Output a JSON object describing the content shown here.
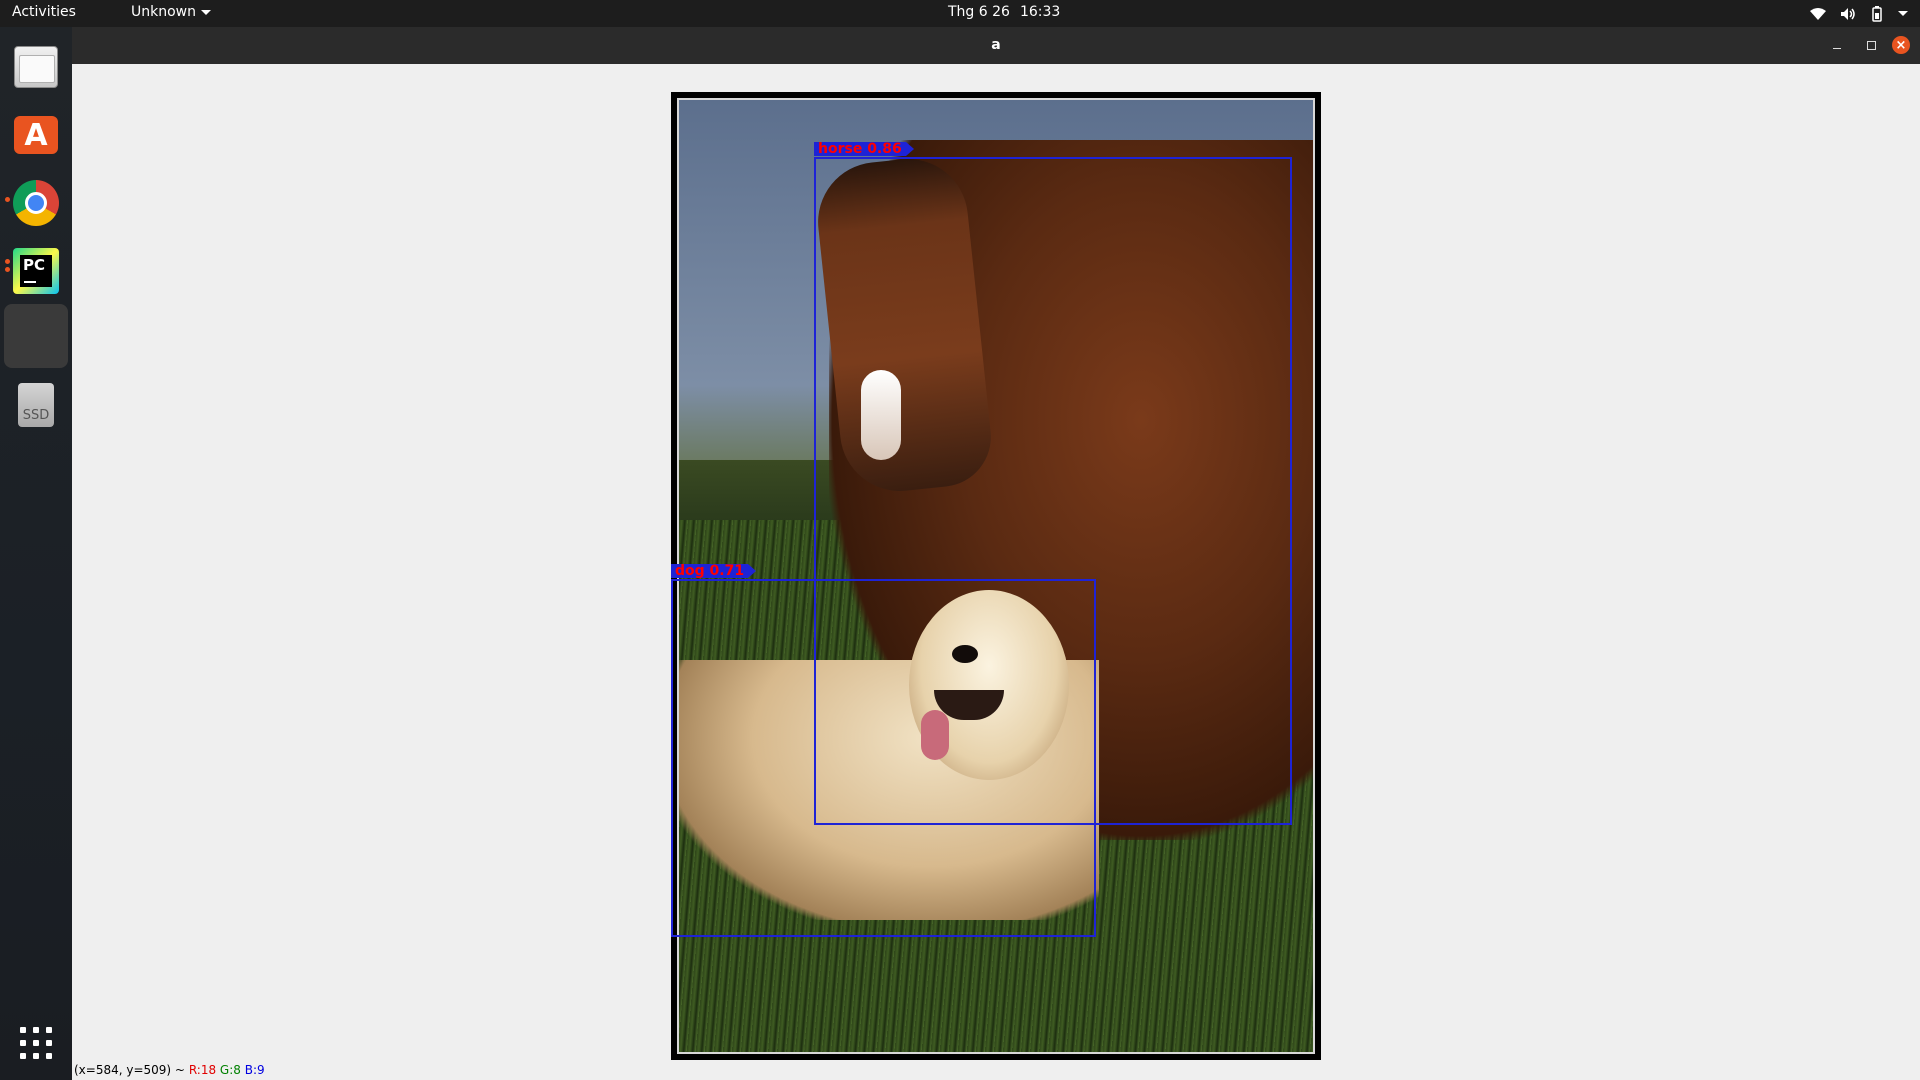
{
  "topbar": {
    "activities": "Activities",
    "app_menu": "Unknown",
    "date": "Thg 6 26",
    "time": "16:33",
    "tray_icons": [
      "wifi-icon",
      "volume-icon",
      "battery-icon",
      "chevron-down-icon"
    ]
  },
  "dock": {
    "items": [
      {
        "name": "files",
        "icon": "files-icon",
        "running": false
      },
      {
        "name": "software",
        "icon": "software-store-icon",
        "label": "A",
        "running": false
      },
      {
        "name": "chrome",
        "icon": "chrome-icon",
        "running": true
      },
      {
        "name": "pycharm",
        "icon": "pycharm-icon",
        "label": "PC",
        "running": true
      },
      {
        "name": "image-window",
        "icon": "window-icon",
        "running": true,
        "active": true
      },
      {
        "name": "ssd",
        "icon": "drive-icon",
        "label": "SSD",
        "running": false
      }
    ],
    "show_apps_icon": "apps-grid-icon"
  },
  "window": {
    "title": "a",
    "buttons": {
      "minimize": "minimize-icon",
      "maximize": "restore-icon",
      "close": "close-icon",
      "close_glyph": "×"
    }
  },
  "detections": [
    {
      "label": "horse 0.86",
      "class": "horse",
      "score": 0.86
    },
    {
      "label": "dog  0.71",
      "class": "dog",
      "score": 0.71
    }
  ],
  "status": {
    "coords": "(x=584, y=509) ~",
    "r": "R:18",
    "g": "G:8",
    "b": "B:9"
  },
  "colors": {
    "accent": "#e95420",
    "bbox": "#1e23d6",
    "label_text": "#ff0000"
  }
}
